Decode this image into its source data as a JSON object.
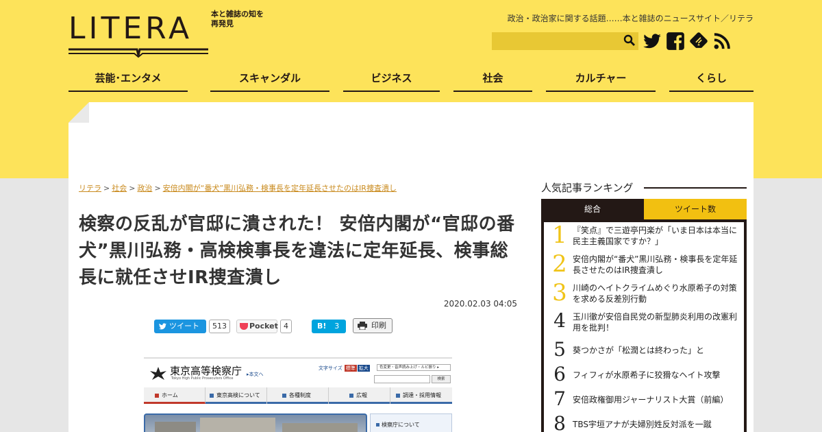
{
  "header": {
    "logo_text": "LITERA",
    "logo_tag": "本と雑誌の知を再発見",
    "tagline": "政治・政治家に関する話題……本と雑誌のニュースサイト／リテラ",
    "search_placeholder": ""
  },
  "social_icons": [
    "twitter-icon",
    "facebook-icon",
    "feedly-icon",
    "rss-icon"
  ],
  "nav": {
    "items": [
      {
        "label": "芸能･エンタメ"
      },
      {
        "label": "スキャンダル"
      },
      {
        "label": "ビジネス"
      },
      {
        "label": "社会"
      },
      {
        "label": "カルチャー"
      },
      {
        "label": "くらし"
      }
    ]
  },
  "breadcrumb": {
    "items": [
      "リテラ",
      "社会",
      "政治",
      "安倍内閣が“番犬”黒川弘務・検事長を定年延長させたのはIR捜査潰し"
    ],
    "separator": ">"
  },
  "article": {
    "title": "検察の反乱が官邸に潰された！ 安倍内閣が“官邸の番犬”黒川弘務・高検検事長を違法に定年延長、検事総長に就任させIR捜査潰し",
    "date": "2020.02.03 04:05"
  },
  "share": {
    "tweet_label": "ツイート",
    "tweet_count": "513",
    "pocket_label": "Pocket",
    "pocket_count": "4",
    "hatena_label": "B!",
    "hatena_count": "3",
    "print_label": "印刷"
  },
  "article_image": {
    "site_name": "東京高等検察庁",
    "site_sub": "Tokyo High Public Prosecutors Office",
    "skip_link": "▸本文へ",
    "text_size_label": "文字サイズ",
    "text_size_std": "標準",
    "text_size_big": "拡大",
    "access_label": "色変更・音声読み上げ・ルビ振り ▸",
    "search_btn": "検索",
    "nav": [
      "ホーム",
      "東京高検について",
      "各種制度",
      "広報",
      "調達・採用情報"
    ],
    "side_label": "検察庁について"
  },
  "ranking": {
    "title": "人気記事ランキング",
    "tab_total": "総合",
    "tab_tweet": "ツイート数",
    "items": [
      {
        "rank": "1",
        "text": "『笑点』で三遊亭円楽が「いま日本は本当に民主主義国家ですか？」"
      },
      {
        "rank": "2",
        "text": "安倍内閣が“番犬”黒川弘務・検事長を定年延長させたのはIR捜査潰し"
      },
      {
        "rank": "3",
        "text": "川崎のヘイトクライムめぐり水原希子の対策を求める反差別行動"
      },
      {
        "rank": "4",
        "text": "玉川徹が安倍自民党の新型肺炎利用の改憲利用を批判！"
      },
      {
        "rank": "5",
        "text": "葵つかさが「松潤とは終わった」と"
      },
      {
        "rank": "6",
        "text": "フィフィが水原希子に狡猾なヘイト攻撃"
      },
      {
        "rank": "7",
        "text": "安倍政権御用ジャーナリスト大賞（前編）"
      },
      {
        "rank": "8",
        "text": "TBS宇垣アナが夫婦別姓反対派を一蹴"
      }
    ]
  },
  "colors": {
    "brand_yellow": "#fde35a",
    "dark": "#231815",
    "link": "#c98a1d",
    "rank_top": "#f0c419",
    "tab_yellow": "#f2c011"
  }
}
